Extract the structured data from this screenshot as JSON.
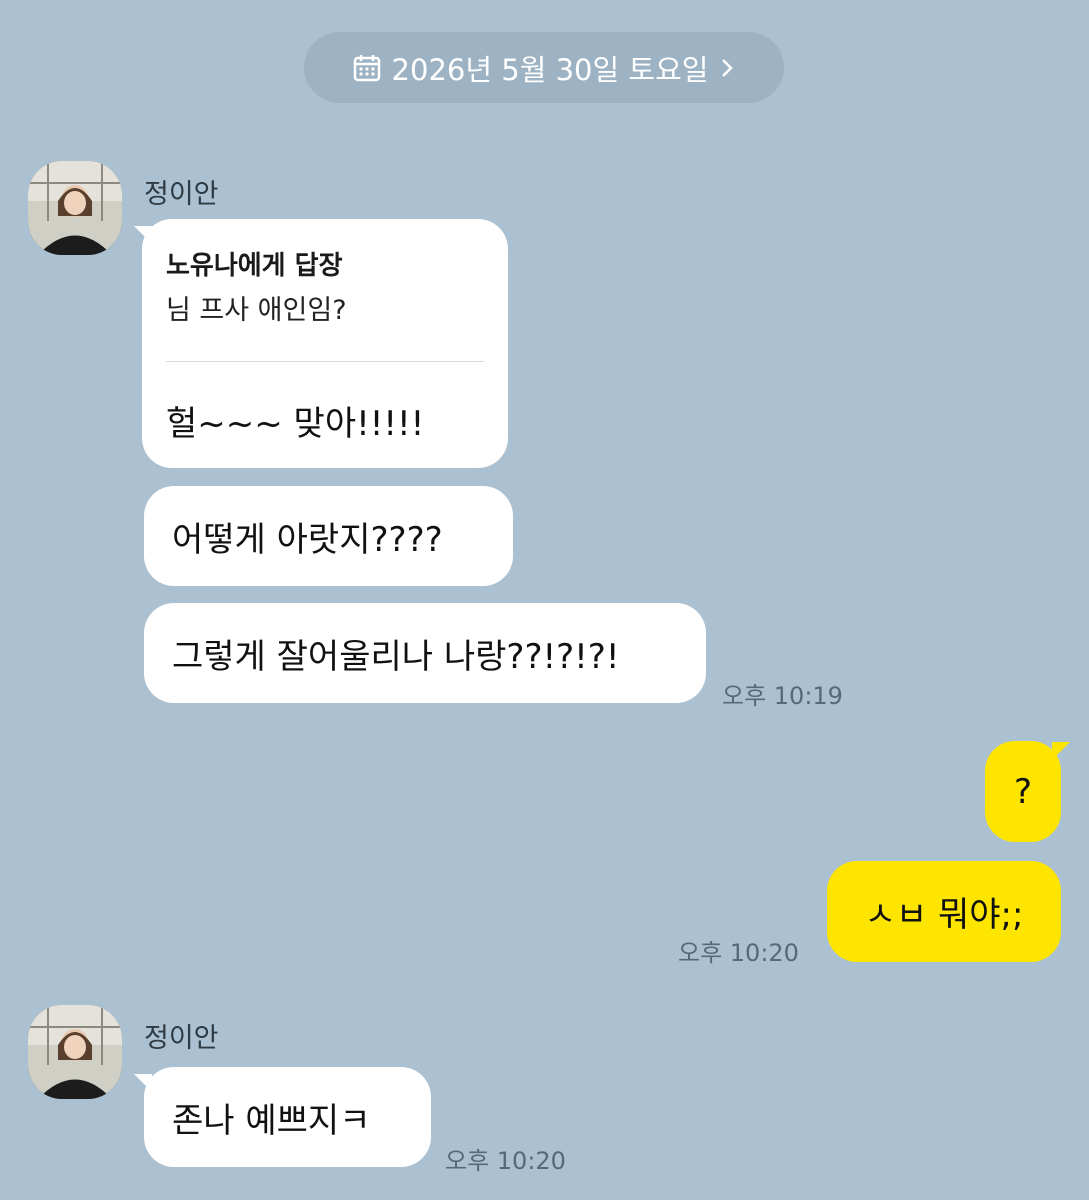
{
  "date_header": {
    "label": "2026년 5월 30일 토요일",
    "icon": "calendar-icon",
    "chevron": "chevron-right-icon"
  },
  "groups": [
    {
      "sender": "정이안",
      "reply": {
        "title": "노유나에게 답장",
        "quote": "님 프사 애인임?",
        "text": "헐~~~ 맞아!!!!!"
      },
      "messages": [
        "어떻게 아랏지????",
        "그렇게 잘어울리나 나랑??!?!?!"
      ],
      "time": "오후 10:19"
    },
    {
      "me": true,
      "messages": [
        "?",
        "ㅅㅂ 뭐야;;"
      ],
      "time": "오후 10:20"
    },
    {
      "sender": "정이안",
      "messages": [
        "존나 예쁘지ㅋ"
      ],
      "time": "오후 10:20"
    }
  ],
  "colors": {
    "background": "#abc1d1",
    "my_bubble": "#fee500",
    "their_bubble": "#ffffff",
    "date_pill": "#9db3c3"
  }
}
